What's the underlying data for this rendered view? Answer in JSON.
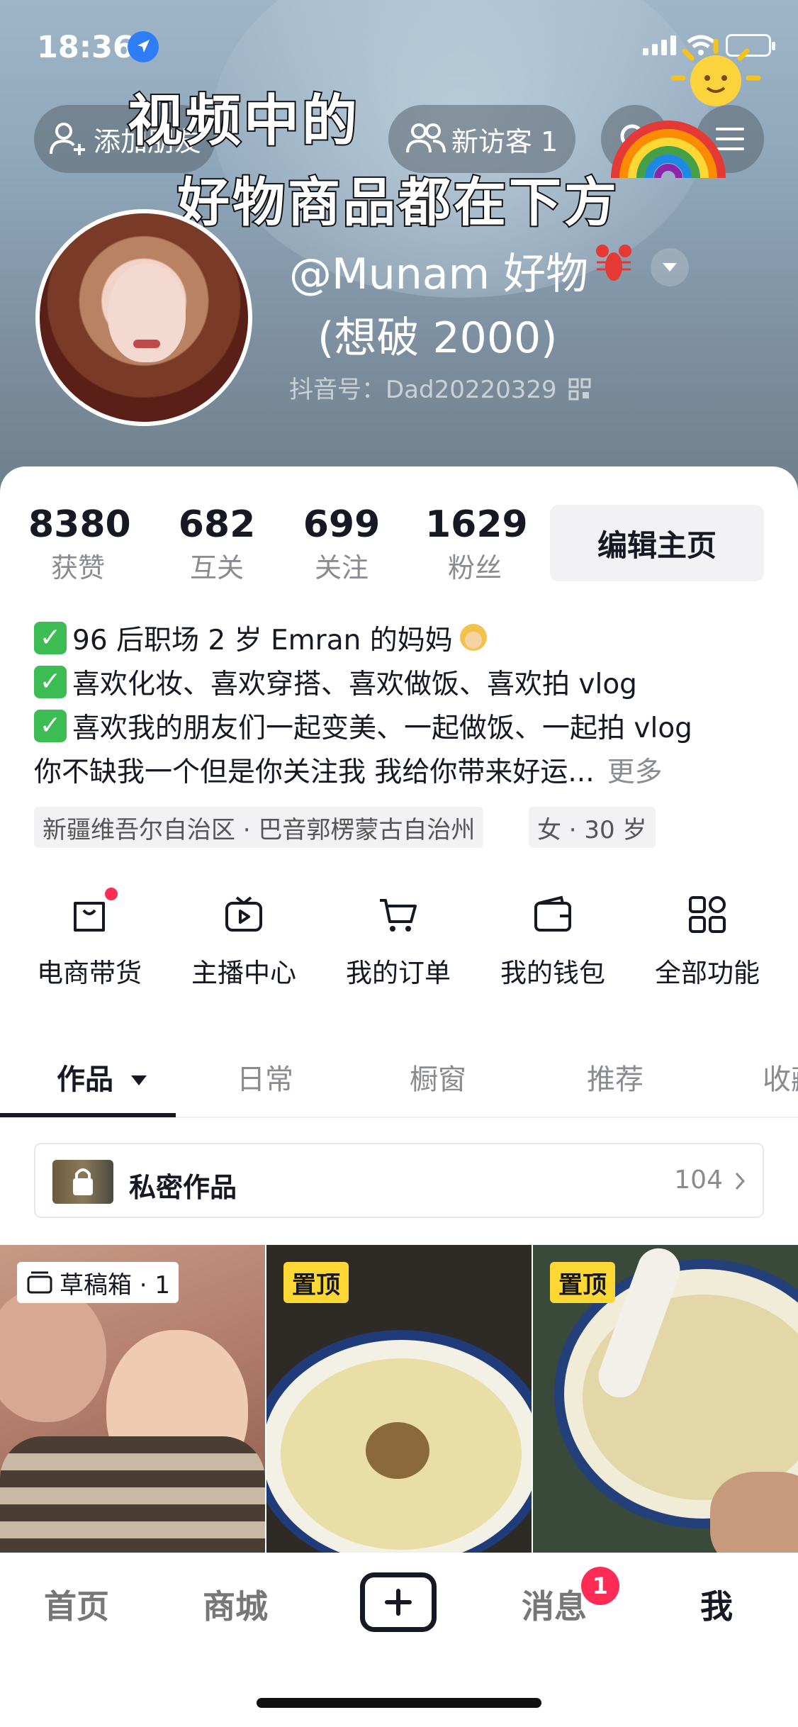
{
  "status_bar": {
    "time": "18:36"
  },
  "header": {
    "add_friend": "添加朋友",
    "new_visitors": "新访客 1",
    "overlay_line1": "视频中的",
    "overlay_line2": "好物商品都在下方",
    "nickname_line1": "@Munam 好物",
    "nickname_line2": "(想破 2000)",
    "douyin_id": "抖音号：Dad20220329"
  },
  "stats": [
    {
      "value": "8380",
      "label": "获赞"
    },
    {
      "value": "682",
      "label": "互关"
    },
    {
      "value": "699",
      "label": "关注"
    },
    {
      "value": "1629",
      "label": "粉丝"
    }
  ],
  "edit_button": "编辑主页",
  "bio": {
    "line1": "96 后职场 2 岁 Emran 的妈妈",
    "line2": "喜欢化妆、喜欢穿搭、喜欢做饭、喜欢拍 vlog",
    "line3": "喜欢我的朋友们一起变美、一起做饭、一起拍 vlog",
    "line4": "你不缺我一个但是你关注我 我给你带来好运...",
    "more": "更多"
  },
  "tags": [
    "新疆维吾尔自治区 · 巴音郭楞蒙古自治州",
    "女 · 30 岁"
  ],
  "functions": [
    {
      "label": "电商带货",
      "icon": "shopping-bag-icon"
    },
    {
      "label": "主播中心",
      "icon": "tv-play-icon"
    },
    {
      "label": "我的订单",
      "icon": "cart-icon"
    },
    {
      "label": "我的钱包",
      "icon": "wallet-icon"
    },
    {
      "label": "全部功能",
      "icon": "apps-icon"
    }
  ],
  "tabs": [
    "作品",
    "日常",
    "橱窗",
    "推荐",
    "收藏"
  ],
  "private_works": {
    "label": "私密作品",
    "count": "104"
  },
  "grid": {
    "draft_badge": "草稿箱 · 1",
    "pinned_badge": "置顶"
  },
  "bottom_nav": {
    "home": "首页",
    "mall": "商城",
    "messages": "消息",
    "message_badge": "1",
    "me": "我"
  },
  "colors": {
    "accent_red": "#fe2c55",
    "pinned_yellow": "#fdd835",
    "check_green": "#3bbd54"
  }
}
